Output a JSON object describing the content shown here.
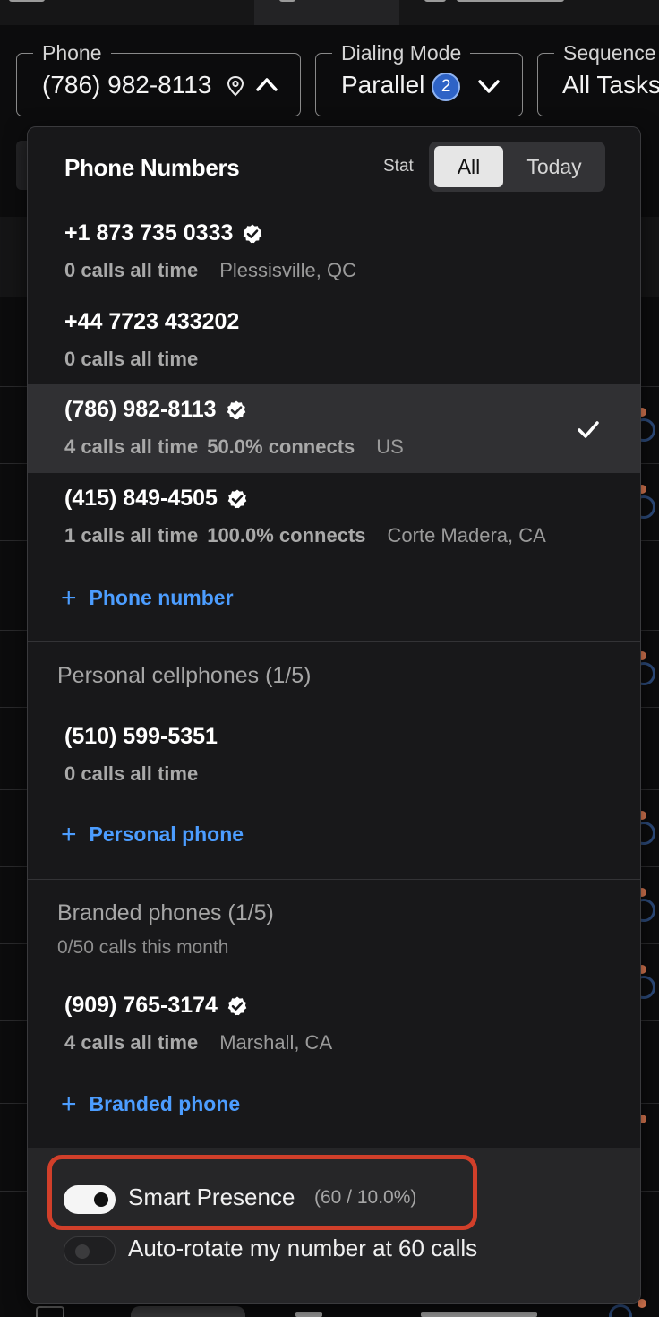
{
  "colors": {
    "accent_blue": "#4c9dff",
    "highlight_red": "#d13f2a",
    "popover_bg": "#18181a",
    "selected_row_bg": "#303033",
    "badge_blue": "#2e63c6"
  },
  "toolbar": {
    "phone": {
      "legend": "Phone",
      "value": "(786) 982-8113",
      "icons": [
        "location-pin-icon",
        "chevron-up-icon"
      ]
    },
    "dialing_mode": {
      "legend": "Dialing Mode",
      "value": "Parallel",
      "badge": "2",
      "icon": "chevron-down-icon"
    },
    "sequence": {
      "legend": "Sequence",
      "value": "All Tasks"
    }
  },
  "popover": {
    "title": "Phone Numbers",
    "stat_label": "Stat",
    "stat_options": [
      "All",
      "Today"
    ],
    "stat_selected": "All",
    "numbers": [
      {
        "number": "+1 873 735 0333",
        "verified": true,
        "calls": "0 calls all time",
        "connects": "",
        "location": "Plessisville, QC",
        "selected": false
      },
      {
        "number": "+44 7723 433202",
        "verified": false,
        "calls": "0 calls all time",
        "connects": "",
        "location": "",
        "selected": false
      },
      {
        "number": "(786) 982-8113",
        "verified": true,
        "calls": "4 calls all time",
        "connects": "50.0% connects",
        "location": "US",
        "selected": true
      },
      {
        "number": "(415) 849-4505",
        "verified": true,
        "calls": "1 calls all time",
        "connects": "100.0% connects",
        "location": "Corte Madera, CA",
        "selected": false
      }
    ],
    "add_phone_label": "Phone number",
    "personal": {
      "title": "Personal cellphones (1/5)",
      "items": [
        {
          "number": "(510) 599-5351",
          "calls": "0 calls all time"
        }
      ],
      "add_label": "Personal phone"
    },
    "branded": {
      "title": "Branded phones (1/5)",
      "subtitle": "0/50 calls this month",
      "items": [
        {
          "number": "(909) 765-3174",
          "verified": true,
          "calls": "4 calls all time",
          "location": "Marshall, CA"
        }
      ],
      "add_label": "Branded phone"
    },
    "footer": {
      "smart_presence": {
        "label": "Smart Presence",
        "detail": "(60 / 10.0%)",
        "on": true
      },
      "auto_rotate": {
        "label": "Auto-rotate my number at 60 calls",
        "on": false
      }
    }
  }
}
